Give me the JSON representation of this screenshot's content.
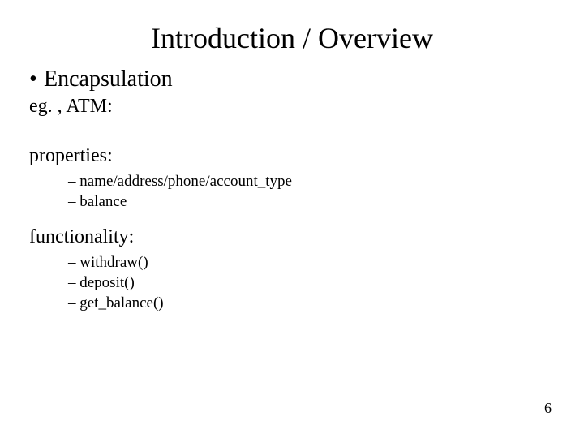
{
  "title": "Introduction / Overview",
  "bullet": {
    "marker": "•",
    "text": "Encapsulation"
  },
  "eg": "eg. ,  ATM:",
  "properties": {
    "heading": "properties:",
    "items": [
      "name/address/phone/account_type",
      "balance"
    ]
  },
  "functionality": {
    "heading": "functionality:",
    "items": [
      "withdraw()",
      "deposit()",
      "get_balance()"
    ]
  },
  "pagenum": "6",
  "dash": "–"
}
